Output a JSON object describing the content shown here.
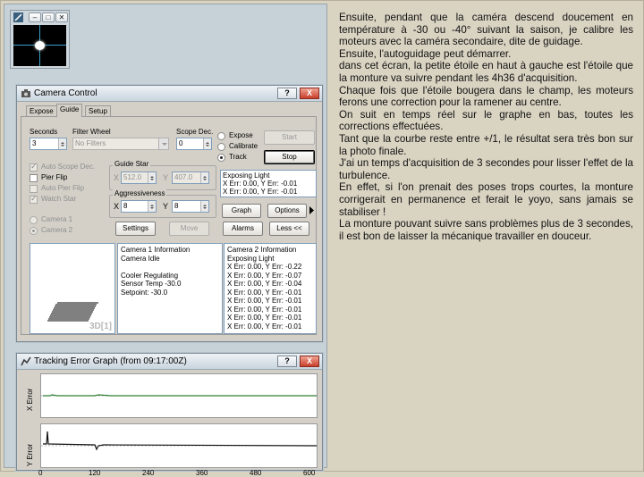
{
  "camera_control": {
    "title": "Camera Control",
    "tabs": [
      "Expose",
      "Guide",
      "Setup"
    ],
    "active_tab": "Guide",
    "seconds_label": "Seconds",
    "seconds_value": "3",
    "filter_wheel_label": "Filter Wheel",
    "filter_wheel_value": "No Filters",
    "scope_dec_label": "Scope Dec.",
    "scope_dec_value": "0",
    "modes": [
      "Expose",
      "Calibrate",
      "Track"
    ],
    "selected_mode": "Track",
    "start_label": "Start",
    "stop_label": "Stop",
    "checkboxes": [
      {
        "label": "Auto Scope Dec.",
        "checked": true,
        "enabled": false
      },
      {
        "label": "Pier Flip",
        "checked": false,
        "enabled": true
      },
      {
        "label": "Auto Pier Flip",
        "checked": false,
        "enabled": false
      },
      {
        "label": "Watch Star",
        "checked": true,
        "enabled": false
      }
    ],
    "guide_star_label": "Guide Star",
    "guide_star_x": "512.0",
    "guide_star_y": "407.0",
    "aggressiveness_label": "Aggressiveness",
    "aggr_x": "8",
    "aggr_y": "8",
    "x_label": "X",
    "y_label": "Y",
    "cameras": [
      "Camera 1",
      "Camera 2"
    ],
    "selected_camera": "Camera 2",
    "status_lines": [
      "Exposing Light",
      "X Err: 0.00, Y Err: -0.01",
      "X Err: 0.00, Y Err: -0.01"
    ],
    "graph_label": "Graph",
    "options_label": "Options",
    "settings_label": "Settings",
    "move_label": "Move",
    "alarms_label": "Alarms",
    "less_label": "Less <<",
    "view_label": "3D[1]",
    "camera1_info": [
      "Camera 1 Information",
      "Camera Idle",
      "",
      "Cooler Regulating",
      "Sensor Temp -30.0",
      "Setpoint: -30.0"
    ],
    "camera2_info": [
      "Camera 2 Information",
      "Exposing Light",
      "X Err: 0.00, Y Err: -0.22",
      "X Err: 0.00, Y Err: -0.07",
      "X Err: 0.00, Y Err: -0.04",
      "X Err: 0.00, Y Err: -0.01",
      "X Err: 0.00, Y Err: -0.01",
      "X Err: 0.00, Y Err: -0.01",
      "X Err: 0.00, Y Err: -0.01",
      "X Err: 0.00, Y Err: -0.01"
    ],
    "help_glyph": "?",
    "close_glyph": "X"
  },
  "tracking_graph": {
    "title": "Tracking Error Graph (from 09:17:00Z)",
    "x_error_label": "X Error",
    "y_error_label": "Y Error",
    "x_ticks": [
      "0",
      "120",
      "240",
      "360",
      "480",
      "600"
    ]
  },
  "article": {
    "paragraphs": [
      "Ensuite, pendant que la caméra descend doucement en température à -30 ou -40° suivant la saison, je calibre les moteurs avec la caméra secondaire, dite de guidage.",
      "Ensuite, l'autoguidage peut démarrer.",
      "dans cet écran, la petite étoile en haut à gauche est l'étoile que la monture va suivre pendant les 4h36 d'acquisition.",
      "Chaque fois que l'étoile bougera dans le champ, les moteurs ferons une correction pour la ramener au centre.",
      "On suit en temps réel sur le graphe en bas, toutes les corrections effectuées.",
      "Tant que la courbe reste entre +/1, le résultat sera très bon sur la photo finale.",
      "J'ai un temps d'acquisition de 3 secondes pour lisser l'effet de la turbulence.",
      "En effet, si l'on prenait des poses trops courtes, la monture corrigerait en permanence et ferait le yoyo, sans jamais se stabiliser !",
      "La monture pouvant suivre sans problèmes plus de 3 secondes, il est bon de laisser la mécanique travailler en douceur."
    ]
  },
  "colors": {
    "page_bg": "#d9d3c2",
    "crosshair": "#3aa0c8",
    "close_red": "#c8402b",
    "graph_trace": "#2e7d32"
  }
}
